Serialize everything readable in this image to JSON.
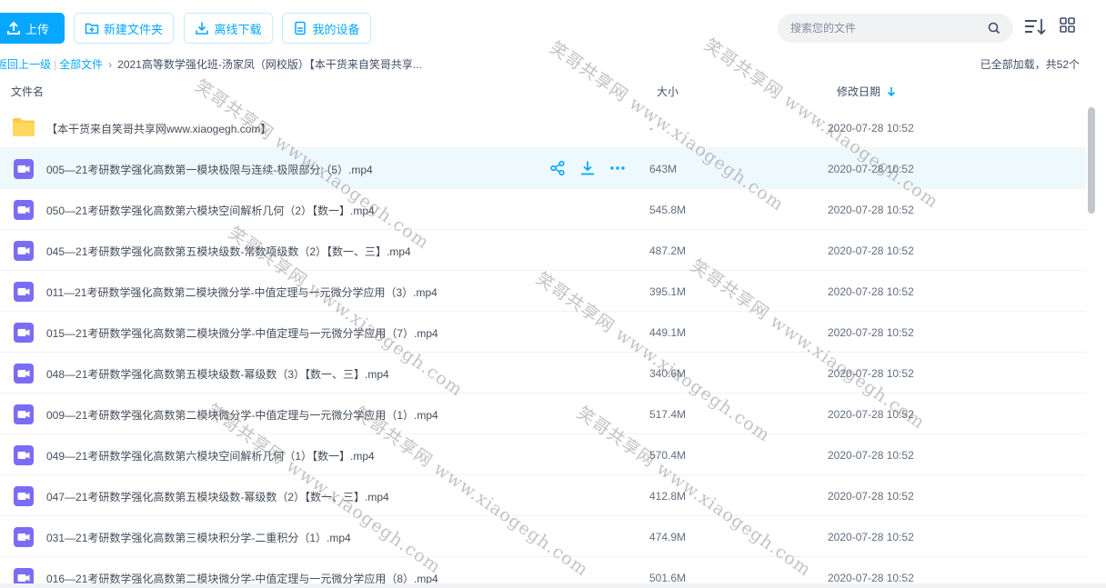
{
  "toolbar": {
    "upload_label": "上传",
    "new_folder_label": "新建文件夹",
    "offline_download_label": "离线下载",
    "my_devices_label": "我的设备"
  },
  "search": {
    "placeholder": "搜索您的文件"
  },
  "breadcrumb": {
    "back": "返回上一级",
    "all_files": "全部文件",
    "current": "2021高等数学强化班-汤家凤（网校版）【本干货来自笑哥共享...",
    "status": "已全部加载，共52个"
  },
  "columns": {
    "name": "文件名",
    "size": "大小",
    "modified": "修改日期"
  },
  "accent_color": "#06a7ff",
  "files": [
    {
      "type": "folder",
      "name": "【本干货来自笑哥共享网www.xiaogegh.com】",
      "size": "-",
      "date": "2020-07-28 10:52"
    },
    {
      "type": "video",
      "name": "005—21考研数学强化高数第一模块极限与连续-极限部分（5）.mp4",
      "size": "643M",
      "date": "2020-07-28 10:52"
    },
    {
      "type": "video",
      "name": "050—21考研数学强化高数第六模块空间解析几何（2）【数一】.mp4",
      "size": "545.8M",
      "date": "2020-07-28 10:52"
    },
    {
      "type": "video",
      "name": "045—21考研数学强化高数第五模块级数-常数项级数（2）【数一、三】.mp4",
      "size": "487.2M",
      "date": "2020-07-28 10:52"
    },
    {
      "type": "video",
      "name": "011—21考研数学强化高数第二模块微分学-中值定理与一元微分学应用（3）.mp4",
      "size": "395.1M",
      "date": "2020-07-28 10:52"
    },
    {
      "type": "video",
      "name": "015—21考研数学强化高数第二模块微分学-中值定理与一元微分学应用（7）.mp4",
      "size": "449.1M",
      "date": "2020-07-28 10:52"
    },
    {
      "type": "video",
      "name": "048—21考研数学强化高数第五模块级数-幂级数（3）【数一、三】.mp4",
      "size": "340.6M",
      "date": "2020-07-28 10:52"
    },
    {
      "type": "video",
      "name": "009—21考研数学强化高数第二模块微分学-中值定理与一元微分学应用（1）.mp4",
      "size": "517.4M",
      "date": "2020-07-28 10:52"
    },
    {
      "type": "video",
      "name": "049—21考研数学强化高数第六模块空间解析几何（1）【数一】.mp4",
      "size": "570.4M",
      "date": "2020-07-28 10:52"
    },
    {
      "type": "video",
      "name": "047—21考研数学强化高数第五模块级数-幂级数（2）【数一、三】.mp4",
      "size": "412.8M",
      "date": "2020-07-28 10:52"
    },
    {
      "type": "video",
      "name": "031—21考研数学强化高数第三模块积分学-二重积分（1）.mp4",
      "size": "474.9M",
      "date": "2020-07-28 10:52"
    },
    {
      "type": "video",
      "name": "016—21考研数学强化高数第二模块微分学-中值定理与一元微分学应用（8）.mp4",
      "size": "501.6M",
      "date": "2020-07-28 10:52"
    }
  ],
  "watermarks": {
    "text_a": "笑哥共享网 www.xiaogegh.com",
    "text_b": "笑哥共享网 www.xiaogegh.com"
  }
}
